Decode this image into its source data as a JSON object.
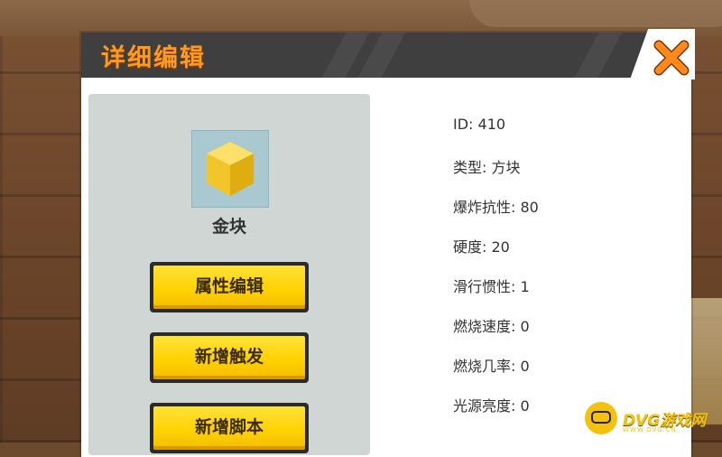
{
  "dialog": {
    "title": "详细编辑",
    "close_icon": "close-x-icon"
  },
  "item": {
    "icon": "gold-block-icon",
    "name": "金块"
  },
  "actions": [
    {
      "label": "属性编辑"
    },
    {
      "label": "新增触发"
    },
    {
      "label": "新增脚本"
    }
  ],
  "properties": [
    "ID: 410",
    "类型: 方块",
    "爆炸抗性: 80",
    "硬度: 20",
    "滑行惯性: 1",
    "燃烧速度: 0",
    "燃烧几率: 0",
    "光源亮度: 0"
  ],
  "watermark": {
    "text": "DVG游戏网",
    "sub": "WWW.DVG.CN"
  },
  "colors": {
    "title": "#ff9a1e",
    "close": "#ff8a1a",
    "button": "#ffd200",
    "panel": "#cfd6d4",
    "gold": "#f2c62a"
  }
}
